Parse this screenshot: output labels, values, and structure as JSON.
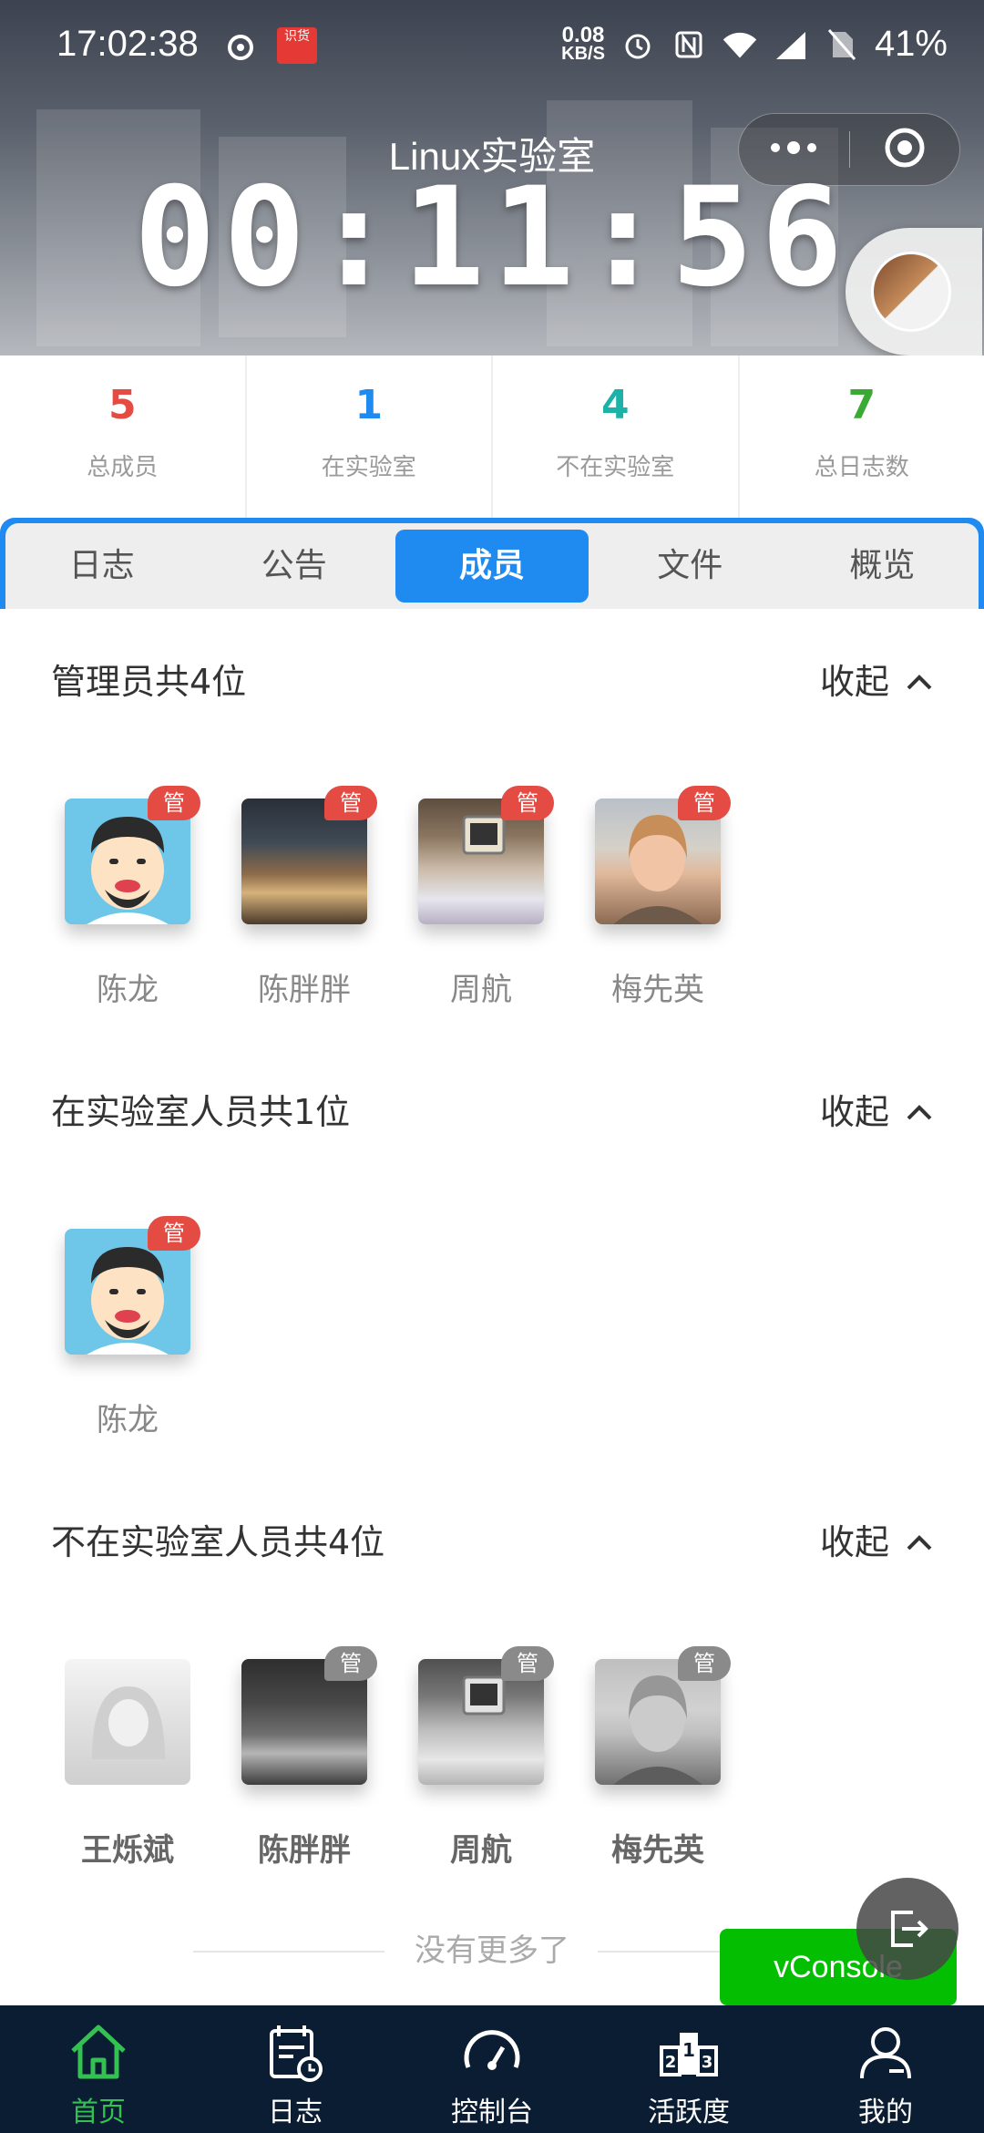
{
  "status_bar": {
    "time": "17:02:38",
    "net_speed_value": "0.08",
    "net_speed_unit": "KB/S",
    "app_badge": "识货",
    "battery": "41%"
  },
  "header": {
    "title": "Linux实验室",
    "timer": "00:11:56"
  },
  "stats": [
    {
      "value": "5",
      "label": "总成员",
      "color": "#e34b43"
    },
    {
      "value": "1",
      "label": "在实验室",
      "color": "#1f8bf0"
    },
    {
      "value": "4",
      "label": "不在实验室",
      "color": "#1bb3a8"
    },
    {
      "value": "7",
      "label": "总日志数",
      "color": "#3aaa35"
    }
  ],
  "tabs": [
    "日志",
    "公告",
    "成员",
    "文件",
    "概览"
  ],
  "active_tab": "成员",
  "sections": {
    "admins": {
      "title": "管理员共4位",
      "collapse": "收起",
      "members": [
        {
          "name": "陈龙",
          "tag": "管"
        },
        {
          "name": "陈胖胖",
          "tag": "管"
        },
        {
          "name": "周航",
          "tag": "管"
        },
        {
          "name": "梅先英",
          "tag": "管"
        }
      ]
    },
    "in_lab": {
      "title": "在实验室人员共1位",
      "collapse": "收起",
      "members": [
        {
          "name": "陈龙",
          "tag": "管"
        }
      ]
    },
    "out_lab": {
      "title": "不在实验室人员共4位",
      "collapse": "收起",
      "members": [
        {
          "name": "王烁斌",
          "tag": ""
        },
        {
          "name": "陈胖胖",
          "tag": "管"
        },
        {
          "name": "周航",
          "tag": "管"
        },
        {
          "name": "梅先英",
          "tag": "管"
        }
      ]
    }
  },
  "footer_text": "没有更多了",
  "vconsole_label": "vConsole",
  "bottom_nav": [
    {
      "label": "首页",
      "icon": "home-icon",
      "active": true
    },
    {
      "label": "日志",
      "icon": "log-calendar-icon",
      "active": false
    },
    {
      "label": "控制台",
      "icon": "dashboard-gauge-icon",
      "active": false
    },
    {
      "label": "活跃度",
      "icon": "podium-ranking-icon",
      "active": false
    },
    {
      "label": "我的",
      "icon": "user-profile-icon",
      "active": false
    }
  ],
  "colors": {
    "accent_blue": "#1f8bf0",
    "admin_red": "#e34b43",
    "nav_bg": "#0b1d33",
    "nav_active": "#33c152",
    "vconsole_green": "#04be02"
  }
}
